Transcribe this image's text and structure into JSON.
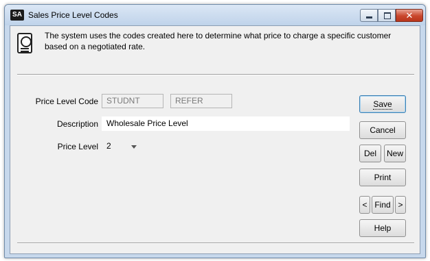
{
  "window": {
    "app_icon": "SA",
    "title": "Sales Price Level Codes"
  },
  "info": {
    "icon": "document-gear-icon",
    "message": "The system uses the codes created here to determine what price to charge a specific customer based on a negotiated rate."
  },
  "form": {
    "price_level_code_label": "Price Level Code",
    "code_value_1": "STUDNT",
    "code_value_2": "REFER",
    "description_label": "Description",
    "description_value": "Wholesale Price Level",
    "price_level_label": "Price Level",
    "price_level_value": "2"
  },
  "buttons": {
    "save": "Save",
    "cancel": "Cancel",
    "del": "Del",
    "new": "New",
    "print": "Print",
    "prev": "<",
    "find": "Find",
    "next": ">",
    "help": "Help"
  },
  "titlebar_buttons": {
    "close_glyph": "✕"
  }
}
